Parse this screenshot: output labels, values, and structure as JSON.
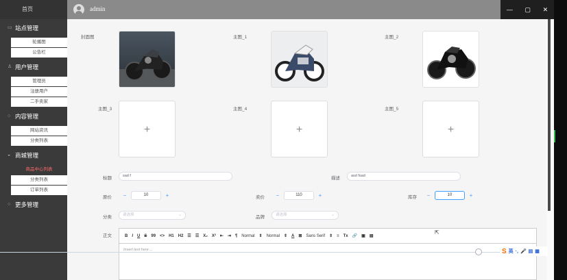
{
  "sidebar": {
    "home": "首页",
    "groups": [
      {
        "label": "站点管理",
        "items": [
          "轮播图",
          "公告栏"
        ]
      },
      {
        "label": "用户管理",
        "items": [
          "管理员",
          "注册用户",
          "二手卖家"
        ]
      },
      {
        "label": "内容管理",
        "items": [
          "网站资讯",
          "分类列表"
        ]
      },
      {
        "label": "商城管理",
        "items": [
          "商品中心列表",
          "分类列表",
          "订单列表"
        ],
        "active": "商品中心列表"
      },
      {
        "label": "更多管理",
        "items": []
      }
    ]
  },
  "topbar": {
    "username": "admin",
    "window_controls": [
      "—",
      "▢",
      "✕"
    ]
  },
  "form": {
    "cover_label": "封面图",
    "main_labels": [
      "主图_1",
      "主图_2",
      "主图_3",
      "主图_4",
      "主图_5"
    ],
    "title_label": "标题",
    "title_value": "sad f",
    "desc_label": "描述",
    "desc_value": "asd fsad",
    "orig_price_label": "原价",
    "orig_price_value": "10",
    "sale_price_label": "卖价",
    "sale_price_value": "110",
    "stock_label": "库存",
    "stock_value": "10",
    "category_label": "分类",
    "category_placeholder": "请选择",
    "brand_label": "品牌",
    "brand_placeholder": "请选择",
    "body_label": "正文",
    "stepper_minus": "−",
    "stepper_plus": "+",
    "upload_plus": "+",
    "select_chevron": "⌄"
  },
  "editor": {
    "toolbar": [
      "B",
      "I",
      "U",
      "S",
      "99",
      "<>",
      "H1",
      "H2",
      "☰",
      "☰",
      "X₂",
      "X²",
      "⇤",
      "⇥",
      "¶",
      "Normal",
      "⇕",
      "Normal",
      "⇕",
      "A",
      "⊠",
      "Sans Serif",
      "⇕",
      "≡",
      "Tx",
      "🔗",
      "▣",
      "▤"
    ],
    "placeholder": "Insert text here ..."
  },
  "ime": {
    "logo": "S",
    "lang": "英",
    "icons": [
      "·,",
      "🎤",
      "▤",
      "▦"
    ]
  }
}
